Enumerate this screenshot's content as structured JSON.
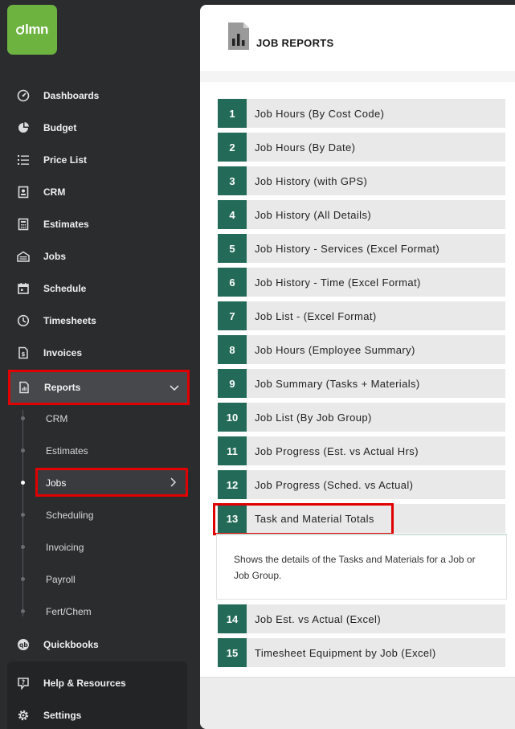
{
  "app": {
    "logo_text": "lmn"
  },
  "sidebar": {
    "items": [
      {
        "label": "Dashboards",
        "icon": "dashboard-icon"
      },
      {
        "label": "Budget",
        "icon": "pie-chart-icon"
      },
      {
        "label": "Price List",
        "icon": "list-icon"
      },
      {
        "label": "CRM",
        "icon": "contact-card-icon"
      },
      {
        "label": "Estimates",
        "icon": "calculator-icon"
      },
      {
        "label": "Jobs",
        "icon": "truck-icon"
      },
      {
        "label": "Schedule",
        "icon": "calendar-icon"
      },
      {
        "label": "Timesheets",
        "icon": "clock-icon"
      },
      {
        "label": "Invoices",
        "icon": "invoice-icon"
      },
      {
        "label": "Reports",
        "icon": "report-icon"
      }
    ],
    "report_subitems": [
      "CRM",
      "Estimates",
      "Jobs",
      "Scheduling",
      "Invoicing",
      "Payroll",
      "Fert/Chem"
    ],
    "active_subitem": "Jobs",
    "bottom_items": [
      {
        "label": "Quickbooks",
        "icon": "quickbooks-icon"
      },
      {
        "label": "Help & Resources",
        "icon": "help-icon"
      },
      {
        "label": "Settings",
        "icon": "gear-icon"
      }
    ]
  },
  "header": {
    "title": "JOB REPORTS"
  },
  "reports": [
    {
      "num": "1",
      "label": "Job Hours (By Cost Code)"
    },
    {
      "num": "2",
      "label": "Job Hours (By Date)"
    },
    {
      "num": "3",
      "label": "Job History (with GPS)"
    },
    {
      "num": "4",
      "label": "Job History (All Details)"
    },
    {
      "num": "5",
      "label": "Job History - Services (Excel Format)"
    },
    {
      "num": "6",
      "label": "Job History - Time (Excel Format)"
    },
    {
      "num": "7",
      "label": "Job List - (Excel Format)"
    },
    {
      "num": "8",
      "label": "Job Hours (Employee Summary)"
    },
    {
      "num": "9",
      "label": "Job Summary (Tasks + Materials)"
    },
    {
      "num": "10",
      "label": "Job List (By Job Group)"
    },
    {
      "num": "11",
      "label": "Job Progress (Est. vs Actual Hrs)"
    },
    {
      "num": "12",
      "label": "Job Progress (Sched. vs Actual)"
    },
    {
      "num": "13",
      "label": "Task and Material Totals"
    },
    {
      "num": "14",
      "label": "Job Est. vs Actual (Excel)"
    },
    {
      "num": "15",
      "label": "Timesheet Equipment by Job (Excel)"
    }
  ],
  "selected_report": {
    "description": "Shows the details of the Tasks and Materials for a Job or Job Group."
  },
  "colors": {
    "accent_green": "#236b58",
    "brand_green": "#6cb33f",
    "highlight_red": "#e00000"
  }
}
